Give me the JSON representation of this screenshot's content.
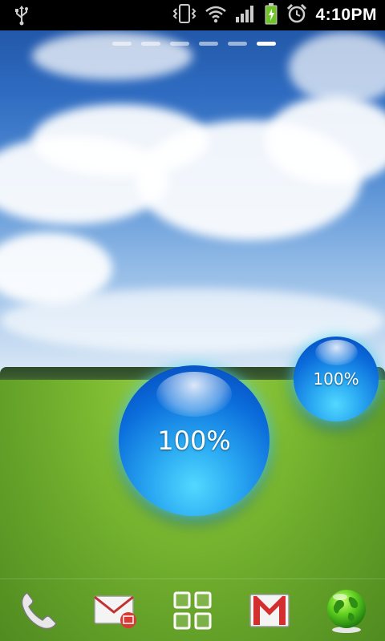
{
  "status_bar": {
    "time": "4:10PM",
    "icons": [
      "usb-icon",
      "vibrate-icon",
      "wifi-icon",
      "signal-icon",
      "battery-charging-icon",
      "alarm-icon"
    ]
  },
  "home_screen": {
    "page_count": 6,
    "active_page": 6
  },
  "widgets": {
    "large_bubble": {
      "label": "100%"
    },
    "small_bubble": {
      "label": "100%"
    }
  },
  "dock": {
    "apps": [
      "phone-icon",
      "messaging-icon",
      "app-drawer-icon",
      "gmail-icon",
      "browser-globe-icon"
    ]
  },
  "colors": {
    "status_bar_bg": "#000000",
    "bubble_blue": "#0b6ddb",
    "bubble_glow": "#52d8ff",
    "grass": "#7dbb32",
    "sky": "#2f6cc1"
  }
}
